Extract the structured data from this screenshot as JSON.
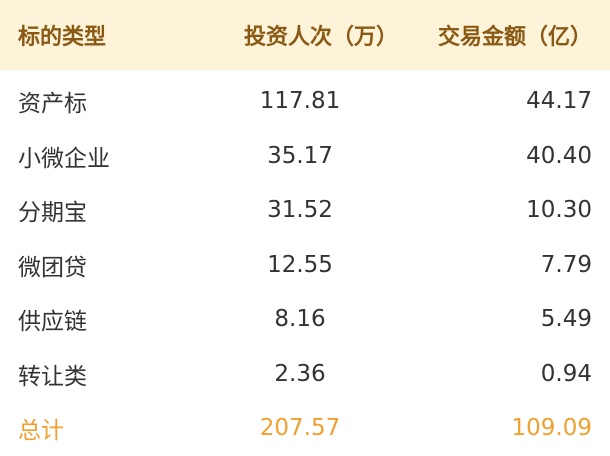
{
  "colors": {
    "header_bg": "#fdf3d8",
    "header_text": "#8a5a14",
    "body_text": "#333333",
    "total_text": "#f0a030"
  },
  "header": {
    "col1": "标的类型",
    "col2": "投资人次（万）",
    "col3": "交易金额（亿）"
  },
  "rows": [
    {
      "type": "资产标",
      "investors": "117.81",
      "amount": "44.17"
    },
    {
      "type": "小微企业",
      "investors": "35.17",
      "amount": "40.40"
    },
    {
      "type": "分期宝",
      "investors": "31.52",
      "amount": "10.30"
    },
    {
      "type": "微团贷",
      "investors": "12.55",
      "amount": "7.79"
    },
    {
      "type": "供应链",
      "investors": "8.16",
      "amount": "5.49"
    },
    {
      "type": "转让类",
      "investors": "2.36",
      "amount": "0.94"
    }
  ],
  "total": {
    "type": "总计",
    "investors": "207.57",
    "amount": "109.09"
  }
}
